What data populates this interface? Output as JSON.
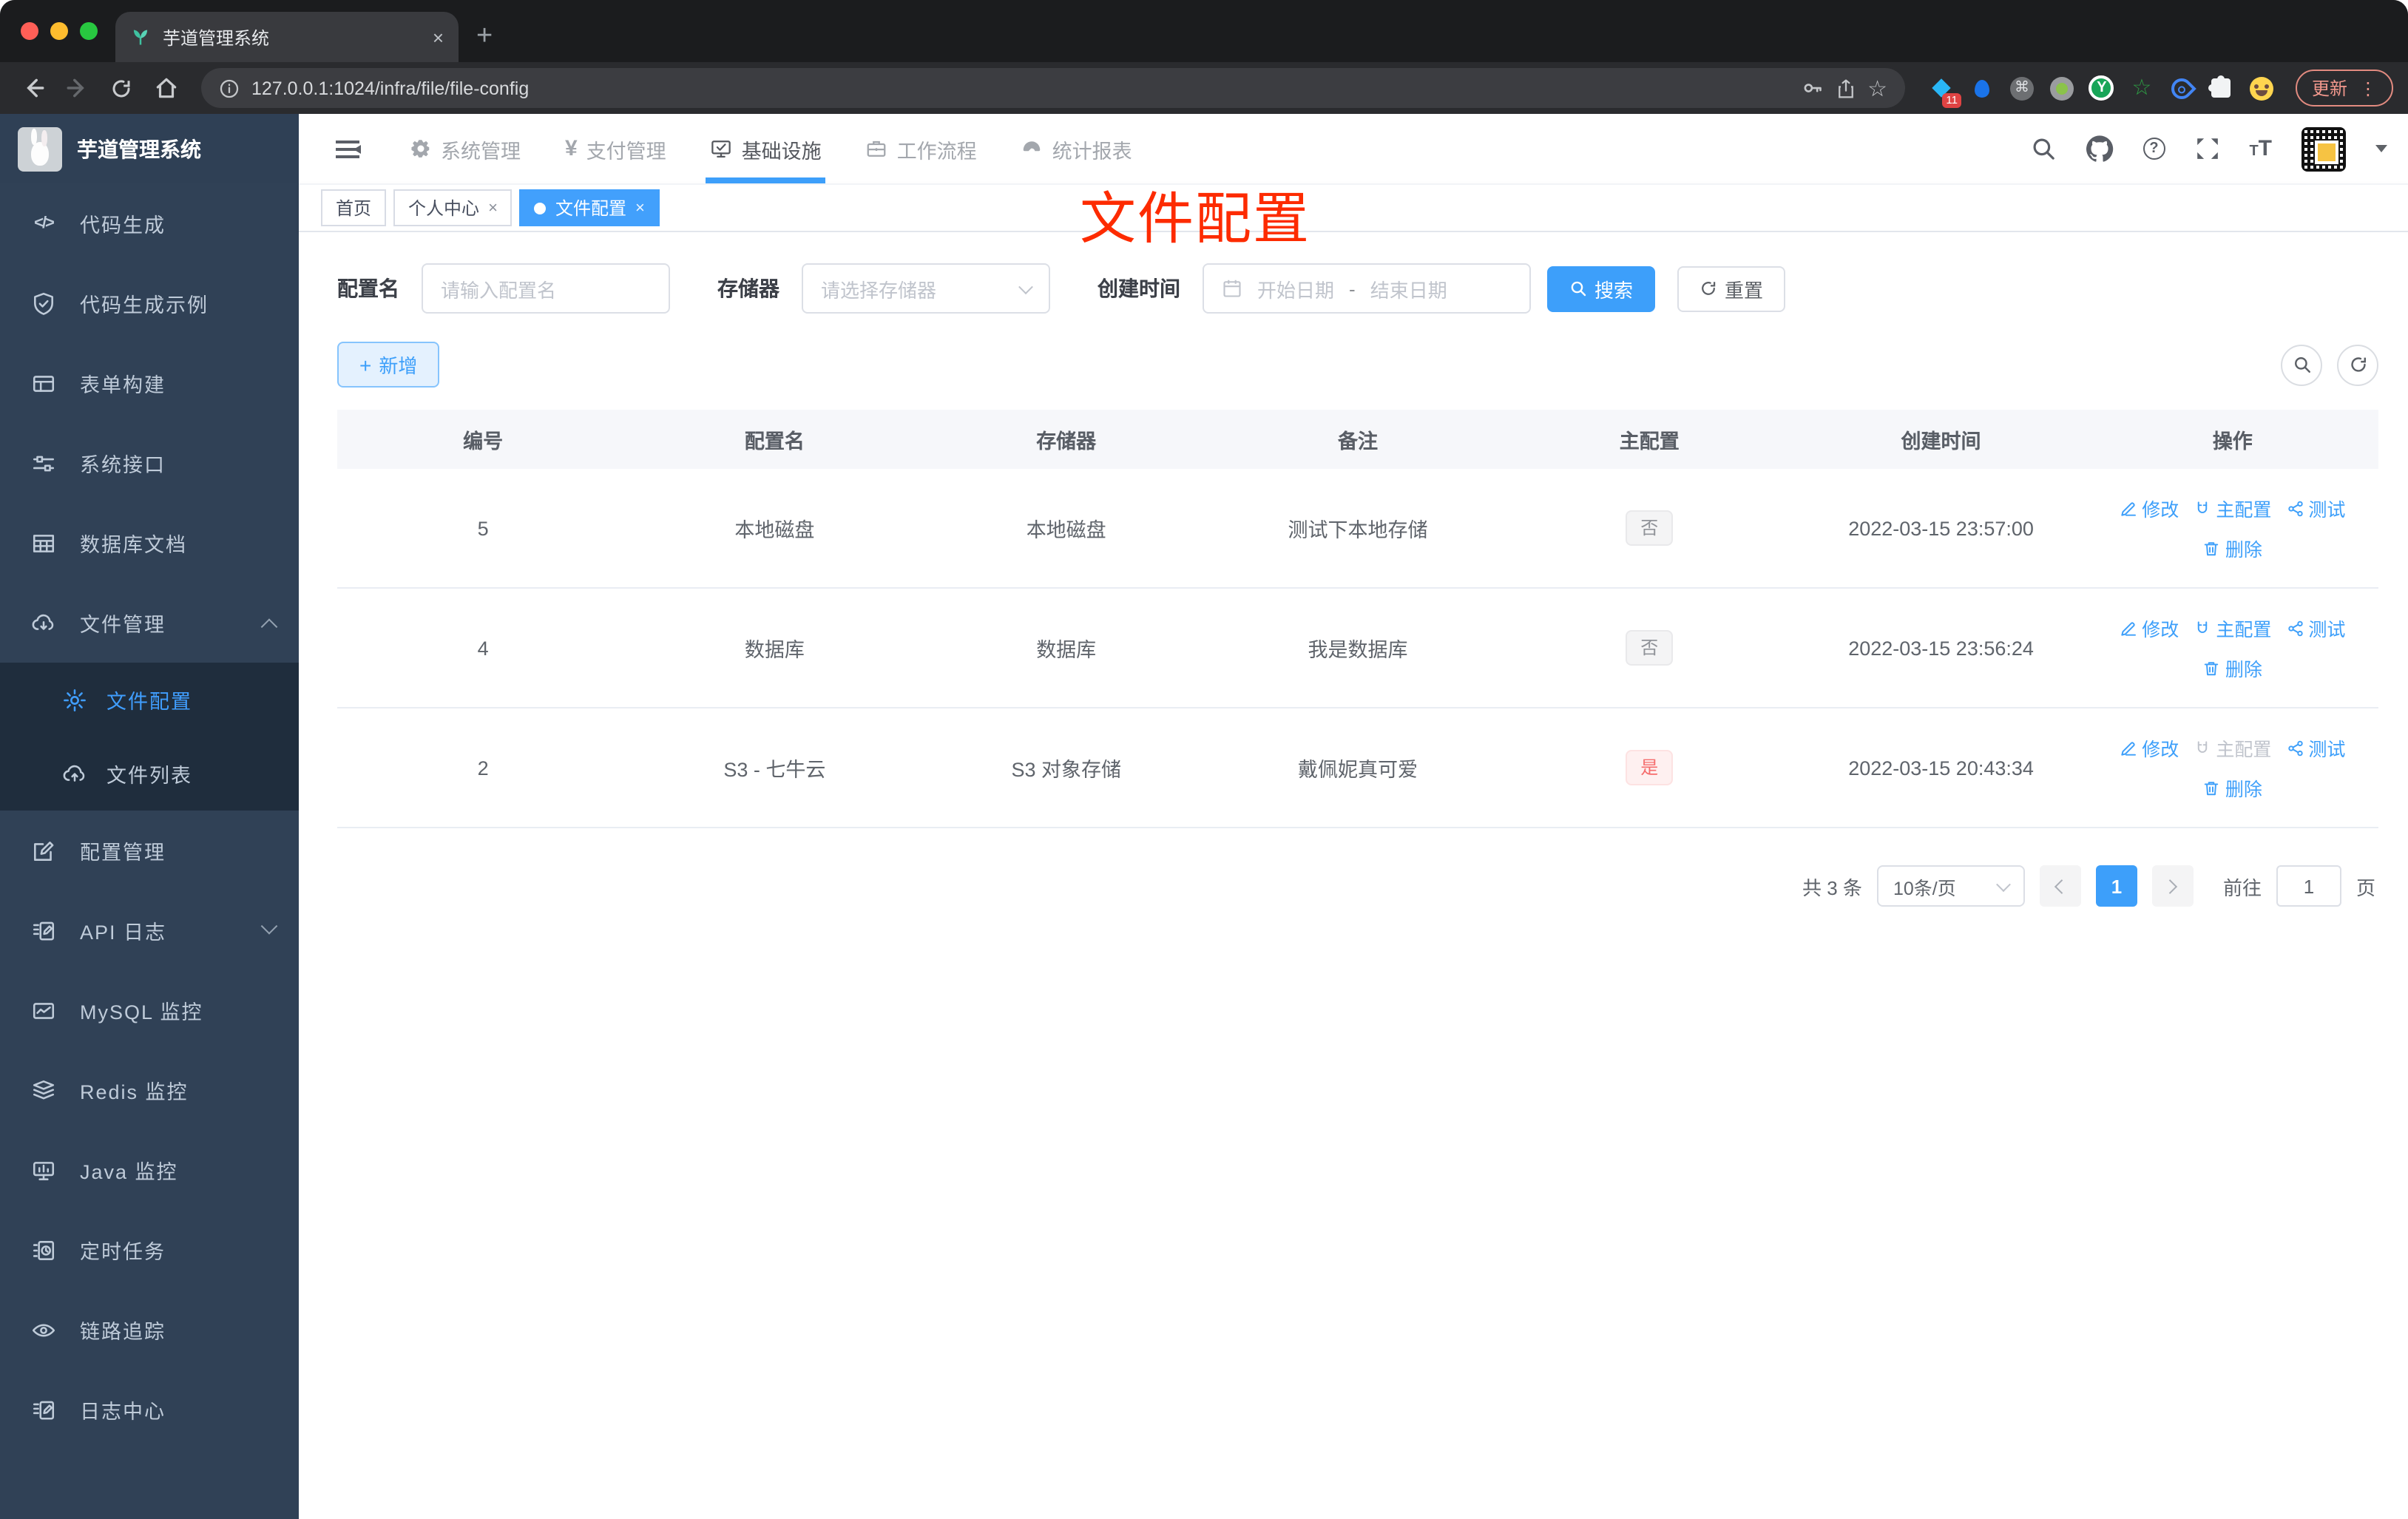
{
  "browser": {
    "tab_title": "芋道管理系统",
    "tab_close": "×",
    "new_tab": "+",
    "url": "127.0.0.1:1024/infra/file/file-config",
    "extensions_badge": "11",
    "update_button": "更新",
    "menu_dots": "⋮",
    "cmd_glyph": "⌘",
    "star_glyph": "☆",
    "y_glyph": "Y"
  },
  "sidebar": {
    "title": "芋道管理系统",
    "items": [
      {
        "label": "代码生成",
        "icon": "code-icon"
      },
      {
        "label": "代码生成示例",
        "icon": "shield-check-icon"
      },
      {
        "label": "表单构建",
        "icon": "form-icon"
      },
      {
        "label": "系统接口",
        "icon": "sliders-icon"
      },
      {
        "label": "数据库文档",
        "icon": "table-grid-icon"
      },
      {
        "label": "文件管理",
        "icon": "cloud-download-icon",
        "expanded": true
      },
      {
        "label": "文件配置",
        "icon": "gear-icon",
        "active": true,
        "sub": true
      },
      {
        "label": "文件列表",
        "icon": "cloud-upload-icon",
        "sub": true
      },
      {
        "label": "配置管理",
        "icon": "edit-square-icon"
      },
      {
        "label": "API 日志",
        "icon": "log-edit-icon",
        "collapsed": true
      },
      {
        "label": "MySQL 监控",
        "icon": "chart-icon"
      },
      {
        "label": "Redis 监控",
        "icon": "layers-icon"
      },
      {
        "label": "Java 监控",
        "icon": "monitor-chart-icon"
      },
      {
        "label": "定时任务",
        "icon": "schedule-icon"
      },
      {
        "label": "链路追踪",
        "icon": "eye-icon"
      },
      {
        "label": "日志中心",
        "icon": "log-edit-icon"
      }
    ]
  },
  "navbar": {
    "menu": [
      {
        "label": "系统管理",
        "icon": "gear-icon"
      },
      {
        "label": "支付管理",
        "icon": "yen-icon"
      },
      {
        "label": "基础设施",
        "icon": "monitor-check-icon",
        "active": true
      },
      {
        "label": "工作流程",
        "icon": "briefcase-icon"
      },
      {
        "label": "统计报表",
        "icon": "dashboard-icon"
      }
    ]
  },
  "tags": [
    {
      "label": "首页"
    },
    {
      "label": "个人中心",
      "closable": true,
      "close": "×"
    },
    {
      "label": "文件配置",
      "active": true,
      "closable": true,
      "close": "×"
    }
  ],
  "annotation": {
    "text": "文件配置",
    "color": "#fd2b00"
  },
  "filter": {
    "name_label": "配置名",
    "name_placeholder": "请输入配置名",
    "storage_label": "存储器",
    "storage_placeholder": "请选择存储器",
    "date_label": "创建时间",
    "date_start": "开始日期",
    "date_separator": "-",
    "date_end": "结束日期",
    "search_button": "搜索",
    "reset_button": "重置"
  },
  "toolbar": {
    "add_button": "新增"
  },
  "table": {
    "headers": [
      "编号",
      "配置名",
      "存储器",
      "备注",
      "主配置",
      "创建时间",
      "操作"
    ],
    "actions": {
      "edit": "修改",
      "master": "主配置",
      "test": "测试",
      "delete": "删除"
    },
    "rows": [
      {
        "id": "5",
        "name": "本地磁盘",
        "storage": "本地磁盘",
        "remark": "测试下本地存储",
        "master": "否",
        "master_type": "info",
        "time": "2022-03-15 23:57:00",
        "master_action_disabled": false
      },
      {
        "id": "4",
        "name": "数据库",
        "storage": "数据库",
        "remark": "我是数据库",
        "master": "否",
        "master_type": "info",
        "time": "2022-03-15 23:56:24",
        "master_action_disabled": false
      },
      {
        "id": "2",
        "name": "S3 - 七牛云",
        "storage": "S3 对象存储",
        "remark": "戴佩妮真可爱",
        "master": "是",
        "master_type": "danger",
        "time": "2022-03-15 20:43:34",
        "master_action_disabled": true
      }
    ]
  },
  "pagination": {
    "total": "共 3 条",
    "per_page": "10条/页",
    "current_page": "1",
    "goto_label": "前往",
    "goto_value": "1",
    "page_suffix": "页"
  },
  "colors": {
    "accent": "#409eff",
    "danger": "#f56c6c",
    "sidebar_bg": "#304156",
    "submenu_bg": "#1f2d3d",
    "annotation_red": "#fd2b00"
  }
}
